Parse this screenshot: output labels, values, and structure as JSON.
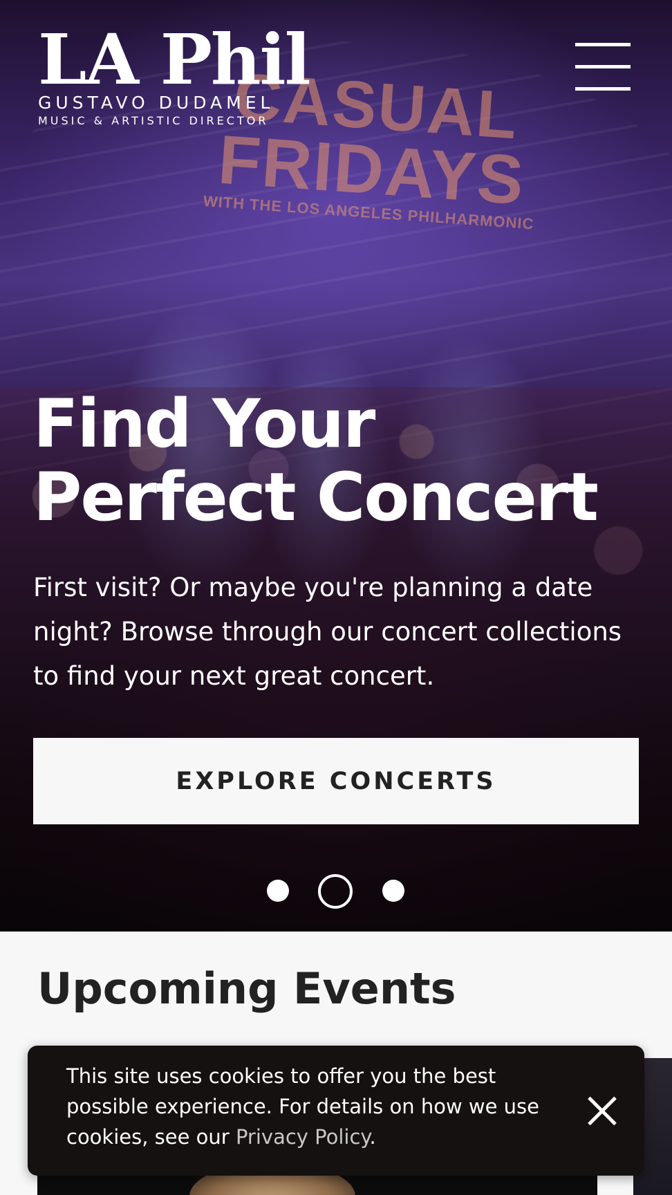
{
  "header": {
    "logo_text": "LA Phil",
    "logo_subtitle": "GUSTAVO DUDAMEL",
    "logo_tagline": "MUSIC & ARTISTIC DIRECTOR",
    "menu_icon": "hamburger-menu-icon"
  },
  "hero": {
    "background_sign": {
      "line1": "CASUAL",
      "line2": "FRIDAYS",
      "line3": "WITH THE LOS ANGELES PHILHARMONIC"
    },
    "title": "Find Your Perfect Concert",
    "text": "First visit? Or maybe you're planning a date night? Browse through our concert collections to find your next great concert.",
    "cta_label": "EXPLORE CONCERTS",
    "carousel": {
      "slide_count": 3,
      "active_index": 2
    }
  },
  "events": {
    "title": "Upcoming Events"
  },
  "cookie_banner": {
    "text": "This site uses cookies to offer you the best possible experience. For details on how we use cookies, see our ",
    "link_label": "Privacy Policy",
    "trailing": ".",
    "close_icon": "close-icon"
  },
  "colors": {
    "background": "#f7f7f7",
    "text_dark": "#222222",
    "banner_bg": "#151111",
    "link_gray": "#c8c8c8"
  }
}
